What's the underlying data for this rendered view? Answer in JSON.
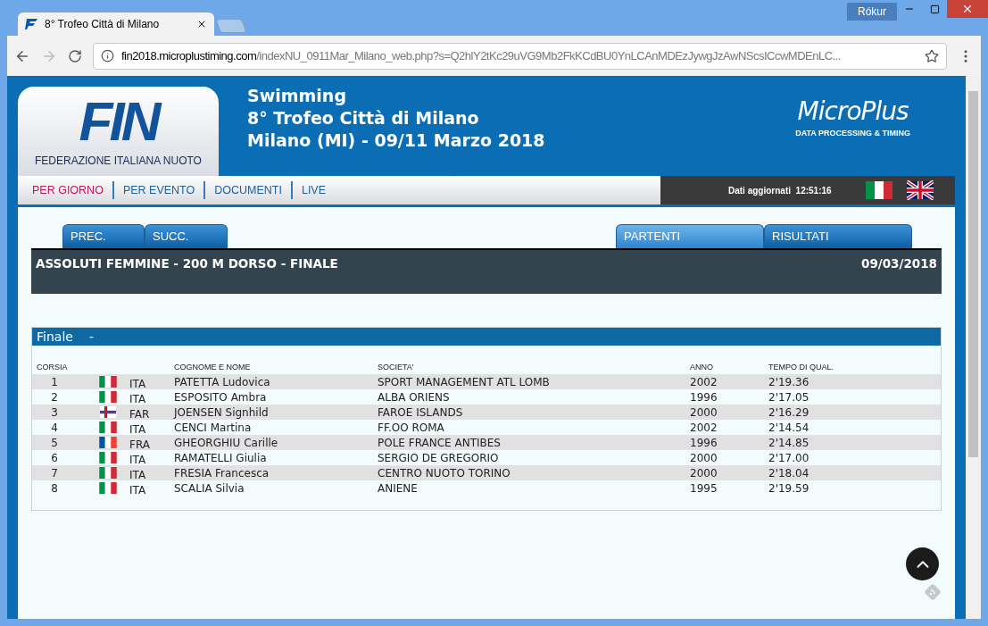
{
  "browser": {
    "tab_title": "8° Trofeo Città di Milano",
    "user": "Rókur",
    "url_host": "fin2018.microplustiming.com",
    "url_path": "/indexNU_0911Mar_Milano_web.php?s=Q2hlY2tKc29uVG9Mb2FkKCdBU0YnLCAnMDEzJywgJzAwNScsICcwMDEnLC..."
  },
  "header": {
    "logo_text": "FIN",
    "logo_caption": "FEDERAZIONE ITALIANA NUOTO",
    "lines": [
      "Swimming",
      "8° Trofeo Città di Milano",
      "Milano (MI) - 09/11 Marzo 2018"
    ],
    "sponsor": "MicroPlus",
    "sponsor_caption": "DATA PROCESSING & TIMING"
  },
  "nav": [
    {
      "label": "PER GIORNO",
      "selected": true
    },
    {
      "label": "PER EVENTO",
      "selected": false
    },
    {
      "label": "DOCUMENTI",
      "selected": false
    },
    {
      "label": "LIVE",
      "selected": false
    }
  ],
  "update": {
    "label": "Dati aggiornati",
    "time": "12:51:16"
  },
  "tabs_left": [
    {
      "label": "PREC.",
      "selected": false
    },
    {
      "label": "SUCC.",
      "selected": false
    }
  ],
  "tabs_right": [
    {
      "label": "PARTENTI",
      "selected": true
    },
    {
      "label": "RISULTATI",
      "selected": false
    }
  ],
  "event": {
    "title": "ASSOLUTI FEMMINE - 200 M DORSO - FINALE",
    "date": "09/03/2018"
  },
  "section": {
    "title": "Finale",
    "subtitle": "-"
  },
  "table": {
    "columns": [
      "CORSIA",
      "COGNOME E NOME",
      "SOCIETA'",
      "ANNO",
      "TEMPO DI QUAL."
    ],
    "rows": [
      {
        "lane": "1",
        "kind": "italy",
        "nation": "ITA",
        "name": "PATETTA Ludovica",
        "club": "SPORT MANAGEMENT ATL LOMB",
        "year": "2002",
        "time": "2'19.36"
      },
      {
        "lane": "2",
        "kind": "italy",
        "nation": "ITA",
        "name": "ESPOSITO Ambra",
        "club": "ALBA ORIENS",
        "year": "1996",
        "time": "2'17.05"
      },
      {
        "lane": "3",
        "kind": "faroe",
        "nation": "FAR",
        "name": "JOENSEN Signhild",
        "club": "FAROE ISLANDS",
        "year": "2000",
        "time": "2'16.29"
      },
      {
        "lane": "4",
        "kind": "italy",
        "nation": "ITA",
        "name": "CENCI Martina",
        "club": "FF.OO ROMA",
        "year": "2002",
        "time": "2'14.54"
      },
      {
        "lane": "5",
        "kind": "france",
        "nation": "FRA",
        "name": "GHEORGHIU Carille",
        "club": "POLE FRANCE ANTIBES",
        "year": "1996",
        "time": "2'14.85"
      },
      {
        "lane": "6",
        "kind": "italy",
        "nation": "ITA",
        "name": "RAMATELLI Giulia",
        "club": "SERGIO DE GREGORIO",
        "year": "2000",
        "time": "2'17.00"
      },
      {
        "lane": "7",
        "kind": "italy",
        "nation": "ITA",
        "name": "FRESIA Francesca",
        "club": "CENTRO NUOTO TORINO",
        "year": "2000",
        "time": "2'18.04"
      },
      {
        "lane": "8",
        "kind": "italy",
        "nation": "ITA",
        "name": "SCALIA Silvia",
        "club": "ANIENE",
        "year": "1995",
        "time": "2'19.59"
      }
    ]
  }
}
